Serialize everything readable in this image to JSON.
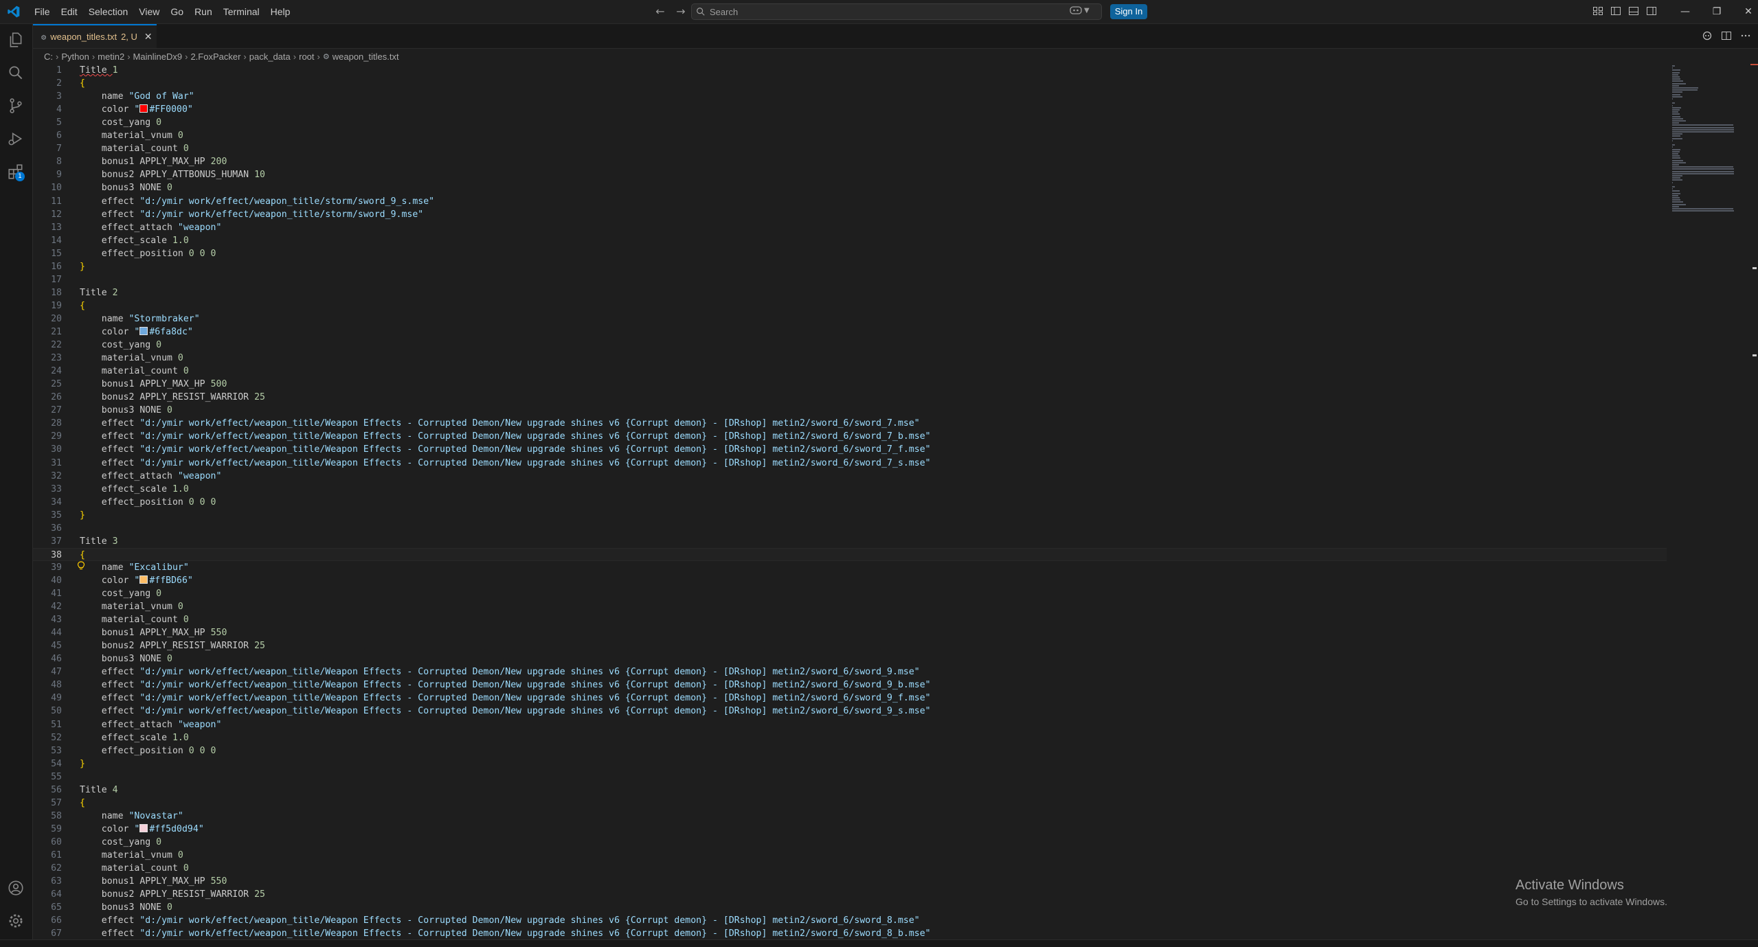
{
  "menu": [
    "File",
    "Edit",
    "Selection",
    "View",
    "Go",
    "Run",
    "Terminal",
    "Help"
  ],
  "search": {
    "placeholder": "Search"
  },
  "signin_label": "Sign In",
  "tab": {
    "filename": "weapon_titles.txt",
    "badge": "2, U",
    "icon": "gear-file-icon"
  },
  "breadcrumb": [
    "C:",
    "Python",
    "metin2",
    "MainlineDx9",
    "2.FoxPacker",
    "pack_data",
    "root",
    "weapon_titles.txt"
  ],
  "activity_badge": "1",
  "colors": {
    "accent": "#0078d4",
    "gold": "#ffd700",
    "string": "#9cdcfe",
    "number": "#b5cea8"
  },
  "current_line": 38,
  "editor_lines": [
    {
      "n": "1",
      "parts": [
        [
          "kw",
          "Title "
        ],
        [
          "num",
          "1"
        ]
      ]
    },
    {
      "n": "2",
      "parts": [
        [
          "brace",
          "{"
        ]
      ]
    },
    {
      "n": "3",
      "parts": [
        [
          "kw",
          "    name "
        ],
        [
          "str",
          "\"God of War\""
        ]
      ]
    },
    {
      "n": "4",
      "parts": [
        [
          "kw",
          "    color "
        ],
        [
          "str",
          "\""
        ],
        [
          "swatch",
          "#FF0000"
        ],
        [
          "str",
          "#FF0000\""
        ]
      ]
    },
    {
      "n": "5",
      "parts": [
        [
          "kw",
          "    cost_yang "
        ],
        [
          "num",
          "0"
        ]
      ]
    },
    {
      "n": "6",
      "parts": [
        [
          "kw",
          "    material_vnum "
        ],
        [
          "num",
          "0"
        ]
      ]
    },
    {
      "n": "7",
      "parts": [
        [
          "kw",
          "    material_count "
        ],
        [
          "num",
          "0"
        ]
      ]
    },
    {
      "n": "8",
      "parts": [
        [
          "kw",
          "    bonus1 APPLY_MAX_HP "
        ],
        [
          "num",
          "200"
        ]
      ]
    },
    {
      "n": "9",
      "parts": [
        [
          "kw",
          "    bonus2 APPLY_ATTBONUS_HUMAN "
        ],
        [
          "num",
          "10"
        ]
      ]
    },
    {
      "n": "10",
      "parts": [
        [
          "kw",
          "    bonus3 NONE "
        ],
        [
          "num",
          "0"
        ]
      ]
    },
    {
      "n": "11",
      "parts": [
        [
          "kw",
          "    effect "
        ],
        [
          "str",
          "\"d:/ymir work/effect/weapon_title/storm/sword_9_s.mse\""
        ]
      ]
    },
    {
      "n": "12",
      "parts": [
        [
          "kw",
          "    effect "
        ],
        [
          "str",
          "\"d:/ymir work/effect/weapon_title/storm/sword_9.mse\""
        ]
      ]
    },
    {
      "n": "13",
      "parts": [
        [
          "kw",
          "    effect_attach "
        ],
        [
          "str",
          "\"weapon\""
        ]
      ]
    },
    {
      "n": "14",
      "parts": [
        [
          "kw",
          "    effect_scale "
        ],
        [
          "num",
          "1.0"
        ]
      ]
    },
    {
      "n": "15",
      "parts": [
        [
          "kw",
          "    effect_position "
        ],
        [
          "num",
          "0 0 0"
        ]
      ]
    },
    {
      "n": "16",
      "parts": [
        [
          "brace",
          "}"
        ]
      ]
    },
    {
      "n": "17",
      "parts": []
    },
    {
      "n": "18",
      "parts": [
        [
          "kw",
          "Title "
        ],
        [
          "num",
          "2"
        ]
      ]
    },
    {
      "n": "19",
      "parts": [
        [
          "brace",
          "{"
        ]
      ]
    },
    {
      "n": "20",
      "parts": [
        [
          "kw",
          "    name "
        ],
        [
          "str",
          "\"Stormbraker\""
        ]
      ]
    },
    {
      "n": "21",
      "parts": [
        [
          "kw",
          "    color "
        ],
        [
          "str",
          "\""
        ],
        [
          "swatch",
          "#6fa8dc"
        ],
        [
          "str",
          "#6fa8dc\""
        ]
      ]
    },
    {
      "n": "22",
      "parts": [
        [
          "kw",
          "    cost_yang "
        ],
        [
          "num",
          "0"
        ]
      ]
    },
    {
      "n": "23",
      "parts": [
        [
          "kw",
          "    material_vnum "
        ],
        [
          "num",
          "0"
        ]
      ]
    },
    {
      "n": "24",
      "parts": [
        [
          "kw",
          "    material_count "
        ],
        [
          "num",
          "0"
        ]
      ]
    },
    {
      "n": "25",
      "parts": [
        [
          "kw",
          "    bonus1 APPLY_MAX_HP "
        ],
        [
          "num",
          "500"
        ]
      ]
    },
    {
      "n": "26",
      "parts": [
        [
          "kw",
          "    bonus2 APPLY_RESIST_WARRIOR "
        ],
        [
          "num",
          "25"
        ]
      ]
    },
    {
      "n": "27",
      "parts": [
        [
          "kw",
          "    bonus3 NONE "
        ],
        [
          "num",
          "0"
        ]
      ]
    },
    {
      "n": "28",
      "parts": [
        [
          "kw",
          "    effect "
        ],
        [
          "str",
          "\"d:/ymir work/effect/weapon_title/Weapon Effects - Corrupted Demon/New upgrade shines v6 {Corrupt demon} - [DRshop] metin2/sword_6/sword_7.mse\""
        ]
      ]
    },
    {
      "n": "29",
      "parts": [
        [
          "kw",
          "    effect "
        ],
        [
          "str",
          "\"d:/ymir work/effect/weapon_title/Weapon Effects - Corrupted Demon/New upgrade shines v6 {Corrupt demon} - [DRshop] metin2/sword_6/sword_7_b.mse\""
        ]
      ]
    },
    {
      "n": "30",
      "parts": [
        [
          "kw",
          "    effect "
        ],
        [
          "str",
          "\"d:/ymir work/effect/weapon_title/Weapon Effects - Corrupted Demon/New upgrade shines v6 {Corrupt demon} - [DRshop] metin2/sword_6/sword_7_f.mse\""
        ]
      ]
    },
    {
      "n": "31",
      "parts": [
        [
          "kw",
          "    effect "
        ],
        [
          "str",
          "\"d:/ymir work/effect/weapon_title/Weapon Effects - Corrupted Demon/New upgrade shines v6 {Corrupt demon} - [DRshop] metin2/sword_6/sword_7_s.mse\""
        ]
      ]
    },
    {
      "n": "32",
      "parts": [
        [
          "kw",
          "    effect_attach "
        ],
        [
          "str",
          "\"weapon\""
        ]
      ]
    },
    {
      "n": "33",
      "parts": [
        [
          "kw",
          "    effect_scale "
        ],
        [
          "num",
          "1.0"
        ]
      ]
    },
    {
      "n": "34",
      "parts": [
        [
          "kw",
          "    effect_position "
        ],
        [
          "num",
          "0 0 0"
        ]
      ]
    },
    {
      "n": "35",
      "parts": [
        [
          "brace",
          "}"
        ]
      ]
    },
    {
      "n": "36",
      "parts": []
    },
    {
      "n": "37",
      "parts": [
        [
          "kw",
          "Title "
        ],
        [
          "num",
          "3"
        ]
      ]
    },
    {
      "n": "38",
      "parts": [
        [
          "brace",
          "{"
        ]
      ]
    },
    {
      "n": "39",
      "parts": [
        [
          "bulb",
          "lightbulb-icon"
        ],
        [
          "kw",
          "    name "
        ],
        [
          "str",
          "\"Excalibur\""
        ]
      ]
    },
    {
      "n": "40",
      "parts": [
        [
          "kw",
          "    color "
        ],
        [
          "str",
          "\""
        ],
        [
          "swatch",
          "#ffbd66"
        ],
        [
          "str",
          "#ffBD66\""
        ]
      ]
    },
    {
      "n": "41",
      "parts": [
        [
          "kw",
          "    cost_yang "
        ],
        [
          "num",
          "0"
        ]
      ]
    },
    {
      "n": "42",
      "parts": [
        [
          "kw",
          "    material_vnum "
        ],
        [
          "num",
          "0"
        ]
      ]
    },
    {
      "n": "43",
      "parts": [
        [
          "kw",
          "    material_count "
        ],
        [
          "num",
          "0"
        ]
      ]
    },
    {
      "n": "44",
      "parts": [
        [
          "kw",
          "    bonus1 APPLY_MAX_HP "
        ],
        [
          "num",
          "550"
        ]
      ]
    },
    {
      "n": "45",
      "parts": [
        [
          "kw",
          "    bonus2 APPLY_RESIST_WARRIOR "
        ],
        [
          "num",
          "25"
        ]
      ]
    },
    {
      "n": "46",
      "parts": [
        [
          "kw",
          "    bonus3 NONE "
        ],
        [
          "num",
          "0"
        ]
      ]
    },
    {
      "n": "47",
      "parts": [
        [
          "kw",
          "    effect "
        ],
        [
          "str",
          "\"d:/ymir work/effect/weapon_title/Weapon Effects - Corrupted Demon/New upgrade shines v6 {Corrupt demon} - [DRshop] metin2/sword_6/sword_9.mse\""
        ]
      ]
    },
    {
      "n": "48",
      "parts": [
        [
          "kw",
          "    effect "
        ],
        [
          "str",
          "\"d:/ymir work/effect/weapon_title/Weapon Effects - Corrupted Demon/New upgrade shines v6 {Corrupt demon} - [DRshop] metin2/sword_6/sword_9_b.mse\""
        ]
      ]
    },
    {
      "n": "49",
      "parts": [
        [
          "kw",
          "    effect "
        ],
        [
          "str",
          "\"d:/ymir work/effect/weapon_title/Weapon Effects - Corrupted Demon/New upgrade shines v6 {Corrupt demon} - [DRshop] metin2/sword_6/sword_9_f.mse\""
        ]
      ]
    },
    {
      "n": "50",
      "parts": [
        [
          "kw",
          "    effect "
        ],
        [
          "str",
          "\"d:/ymir work/effect/weapon_title/Weapon Effects - Corrupted Demon/New upgrade shines v6 {Corrupt demon} - [DRshop] metin2/sword_6/sword_9_s.mse\""
        ]
      ]
    },
    {
      "n": "51",
      "parts": [
        [
          "kw",
          "    effect_attach "
        ],
        [
          "str",
          "\"weapon\""
        ]
      ]
    },
    {
      "n": "52",
      "parts": [
        [
          "kw",
          "    effect_scale "
        ],
        [
          "num",
          "1.0"
        ]
      ]
    },
    {
      "n": "53",
      "parts": [
        [
          "kw",
          "    effect_position "
        ],
        [
          "num",
          "0 0 0"
        ]
      ]
    },
    {
      "n": "54",
      "parts": [
        [
          "brace",
          "}"
        ]
      ]
    },
    {
      "n": "55",
      "parts": []
    },
    {
      "n": "56",
      "parts": [
        [
          "kw",
          "Title "
        ],
        [
          "num",
          "4"
        ]
      ]
    },
    {
      "n": "57",
      "parts": [
        [
          "brace",
          "{"
        ]
      ]
    },
    {
      "n": "58",
      "parts": [
        [
          "kw",
          "    name "
        ],
        [
          "str",
          "\"Novastar\""
        ]
      ]
    },
    {
      "n": "59",
      "parts": [
        [
          "kw",
          "    color "
        ],
        [
          "str",
          "\""
        ],
        [
          "swatch",
          "#f5d0d9"
        ],
        [
          "str",
          "#ff5d0d94\""
        ]
      ]
    },
    {
      "n": "60",
      "parts": [
        [
          "kw",
          "    cost_yang "
        ],
        [
          "num",
          "0"
        ]
      ]
    },
    {
      "n": "61",
      "parts": [
        [
          "kw",
          "    material_vnum "
        ],
        [
          "num",
          "0"
        ]
      ]
    },
    {
      "n": "62",
      "parts": [
        [
          "kw",
          "    material_count "
        ],
        [
          "num",
          "0"
        ]
      ]
    },
    {
      "n": "63",
      "parts": [
        [
          "kw",
          "    bonus1 APPLY_MAX_HP "
        ],
        [
          "num",
          "550"
        ]
      ]
    },
    {
      "n": "64",
      "parts": [
        [
          "kw",
          "    bonus2 APPLY_RESIST_WARRIOR "
        ],
        [
          "num",
          "25"
        ]
      ]
    },
    {
      "n": "65",
      "parts": [
        [
          "kw",
          "    bonus3 NONE "
        ],
        [
          "num",
          "0"
        ]
      ]
    },
    {
      "n": "66",
      "parts": [
        [
          "kw",
          "    effect "
        ],
        [
          "str",
          "\"d:/ymir work/effect/weapon_title/Weapon Effects - Corrupted Demon/New upgrade shines v6 {Corrupt demon} - [DRshop] metin2/sword_6/sword_8.mse\""
        ]
      ]
    },
    {
      "n": "67",
      "parts": [
        [
          "kw",
          "    effect "
        ],
        [
          "str",
          "\"d:/ymir work/effect/weapon_title/Weapon Effects - Corrupted Demon/New upgrade shines v6 {Corrupt demon} - [DRshop] metin2/sword_6/sword_8_b.mse\""
        ]
      ]
    }
  ],
  "watermark": {
    "title": "Activate Windows",
    "subtitle": "Go to Settings to activate Windows."
  }
}
